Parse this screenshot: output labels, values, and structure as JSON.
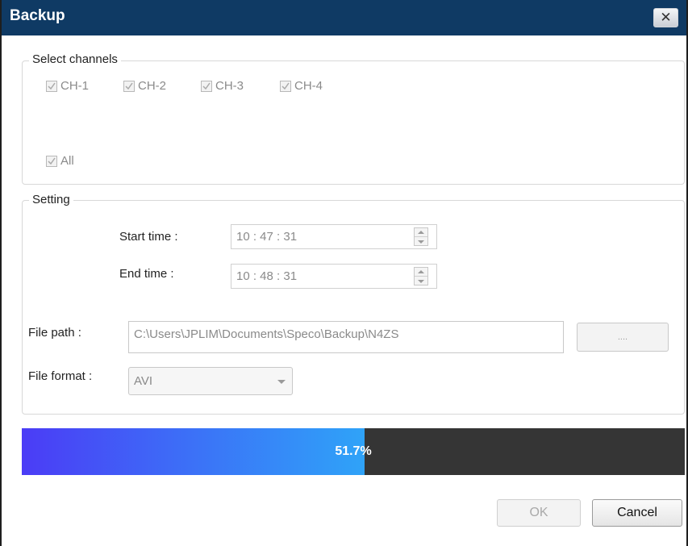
{
  "window": {
    "title": "Backup",
    "close_icon": "close-icon"
  },
  "channels": {
    "group_label": "Select channels",
    "items": [
      {
        "label": "CH-1",
        "checked": true
      },
      {
        "label": "CH-2",
        "checked": true
      },
      {
        "label": "CH-3",
        "checked": true
      },
      {
        "label": "CH-4",
        "checked": true
      }
    ],
    "all": {
      "label": "All",
      "checked": true
    }
  },
  "setting": {
    "group_label": "Setting",
    "start_time": {
      "label": "Start time :",
      "value": "10 : 47 : 31"
    },
    "end_time": {
      "label": "End time :",
      "value": "10 : 48 : 31"
    },
    "file_path": {
      "label": "File path :",
      "value": "C:\\Users\\JPLIM\\Documents\\Speco\\Backup\\N4ZS",
      "browse_label": "...."
    },
    "file_format": {
      "label": "File format :",
      "value": "AVI"
    }
  },
  "progress": {
    "percent": 51.7,
    "text": "51.7%"
  },
  "buttons": {
    "ok": "OK",
    "cancel": "Cancel"
  },
  "colors": {
    "titlebar": "#0f3a64",
    "progress_start": "#4b3cf6",
    "progress_end": "#2fa3f8",
    "progress_track": "#353535"
  }
}
